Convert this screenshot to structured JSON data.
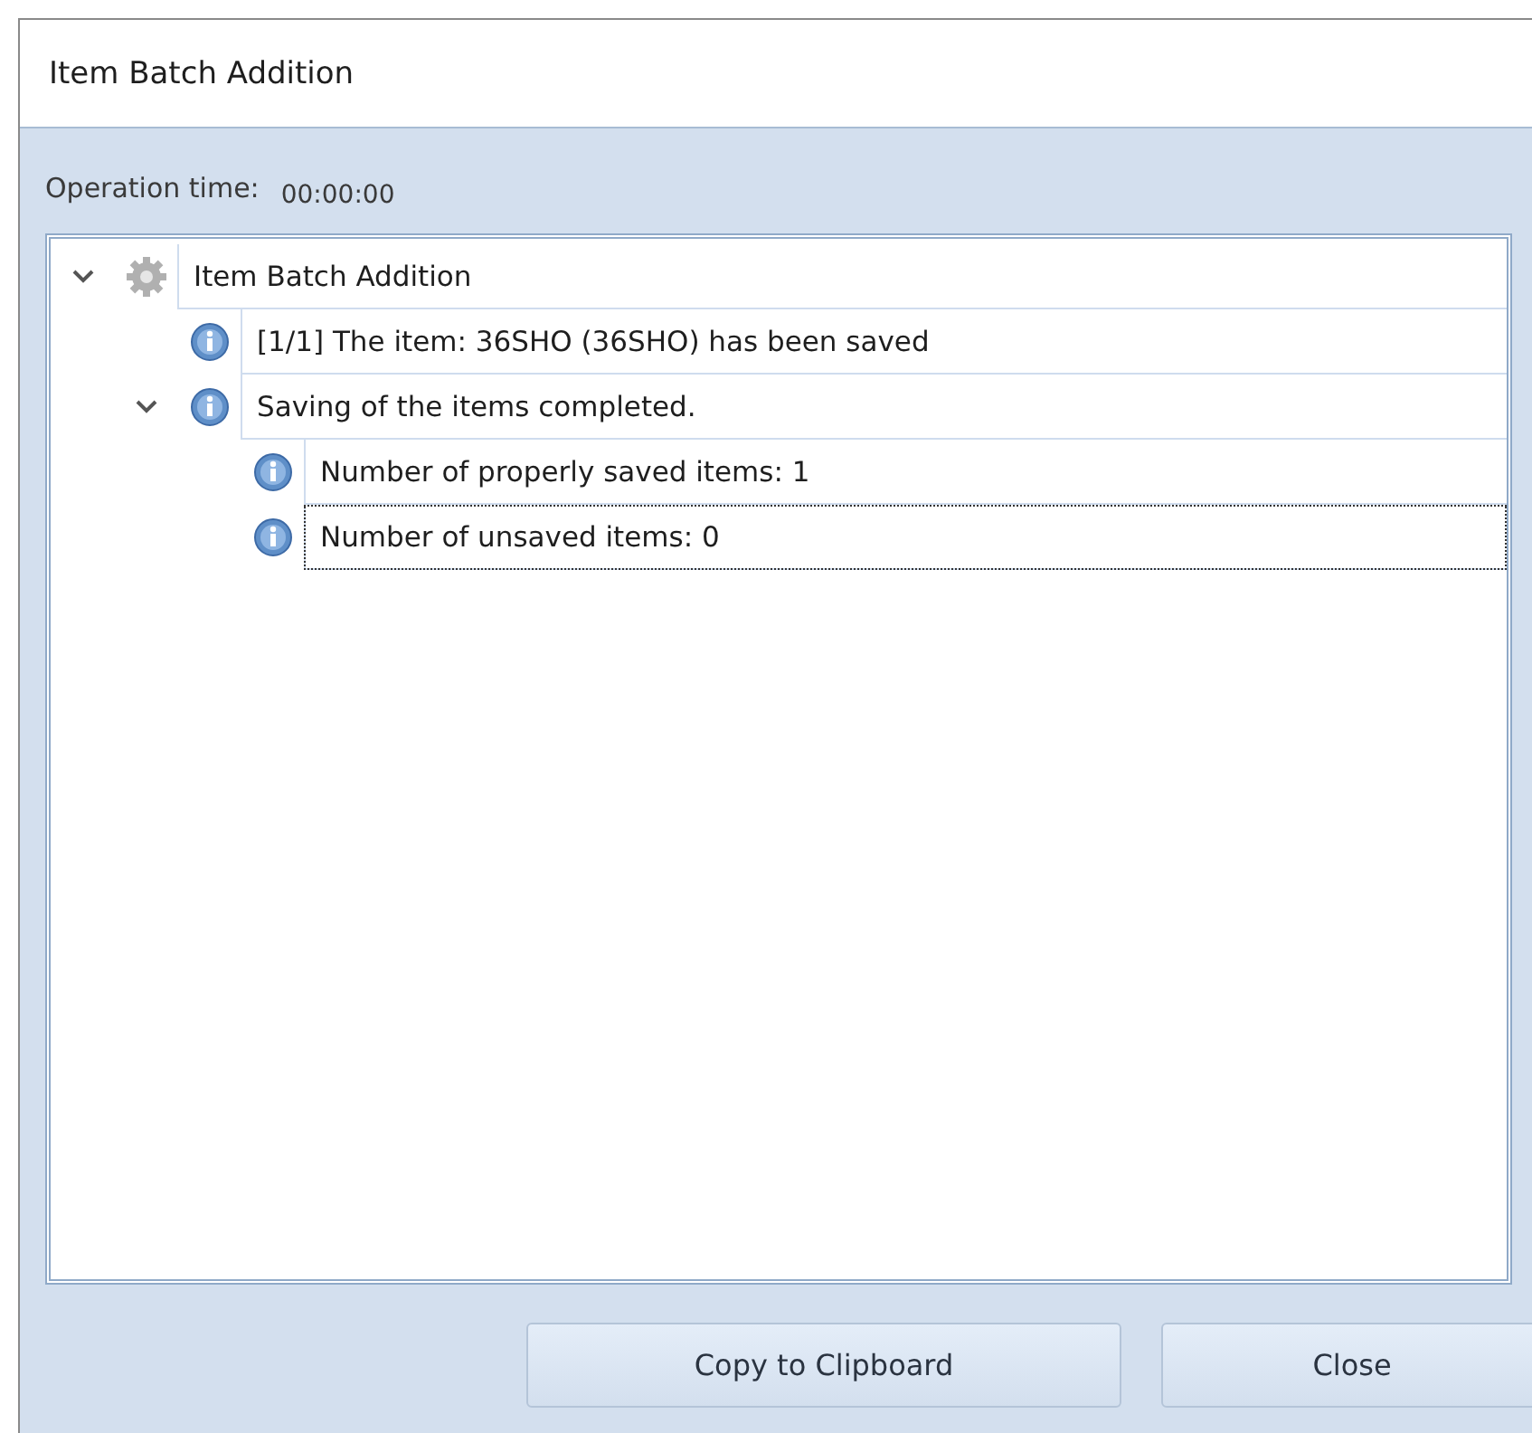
{
  "window": {
    "title": "Item Batch Addition"
  },
  "operation_time": {
    "label": "Operation time:",
    "value": "00:00:00"
  },
  "log_tree": [
    {
      "kind": "process",
      "text": "Item Batch Addition",
      "expanded": true,
      "selected": false,
      "children": [
        {
          "kind": "info",
          "text": "[1/1] The item: 36SHO (36SHO) has been saved",
          "selected": false
        },
        {
          "kind": "info",
          "text": "Saving of the items completed.",
          "expanded": true,
          "selected": false,
          "children": [
            {
              "kind": "info",
              "text": "Number of properly saved items: 1",
              "selected": false
            },
            {
              "kind": "info",
              "text": "Number of unsaved items: 0",
              "selected": true
            }
          ]
        }
      ]
    }
  ],
  "buttons": [
    "Copy to Clipboard",
    "Close"
  ]
}
